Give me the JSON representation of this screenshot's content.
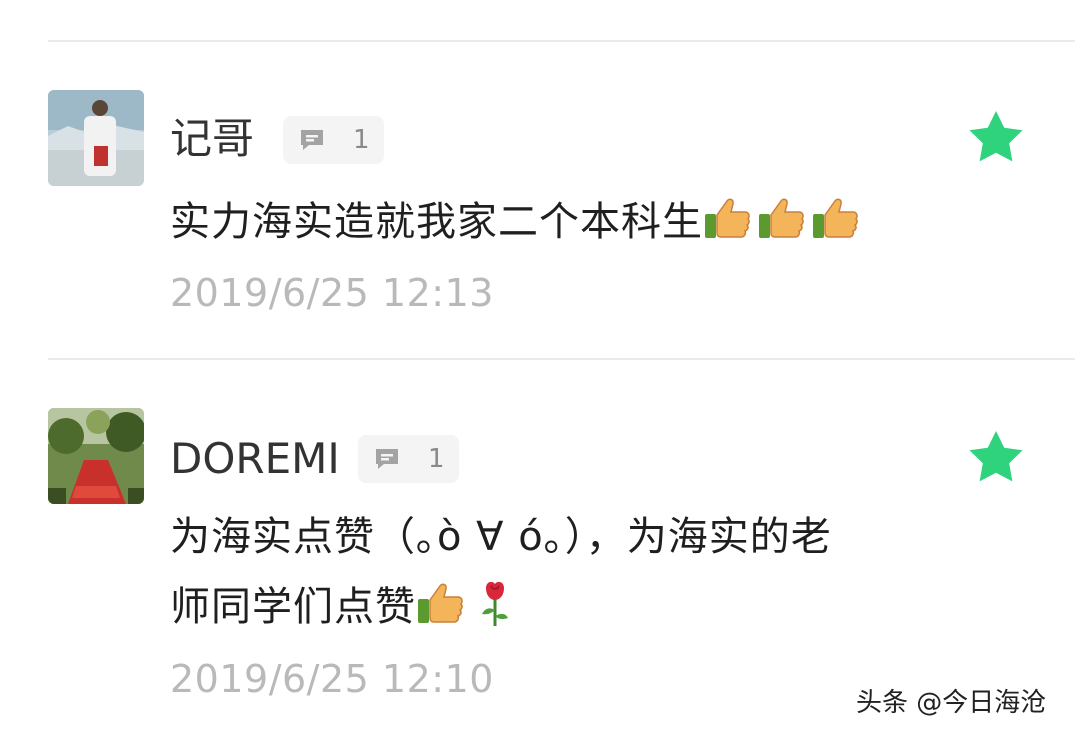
{
  "comments": [
    {
      "author": "记哥",
      "reply_count": "1",
      "text": "实力海实造就我家二个本科生",
      "emojis": [
        "thumbs-up",
        "thumbs-up",
        "thumbs-up"
      ],
      "time": "2019/6/25 12:13"
    },
    {
      "author": "DOREMI",
      "reply_count": "1",
      "text_line1": "为海实点赞（｡ò ∀ ó｡），为海实的老",
      "text_line2": "师同学们点赞",
      "emojis": [
        "thumbs-up",
        "rose"
      ],
      "time": "2019/6/25 12:10"
    }
  ],
  "icons": {
    "reply": "comment-bubble-icon",
    "star": "star-icon",
    "thumbs_up": "thumbs-up-emoji",
    "rose": "rose-emoji"
  },
  "colors": {
    "star": "#2fd37e",
    "divider": "#ebebeb",
    "timestamp": "#b9b9b9",
    "badge_bg": "#f4f4f4"
  },
  "watermark": "头条 @今日海沧"
}
